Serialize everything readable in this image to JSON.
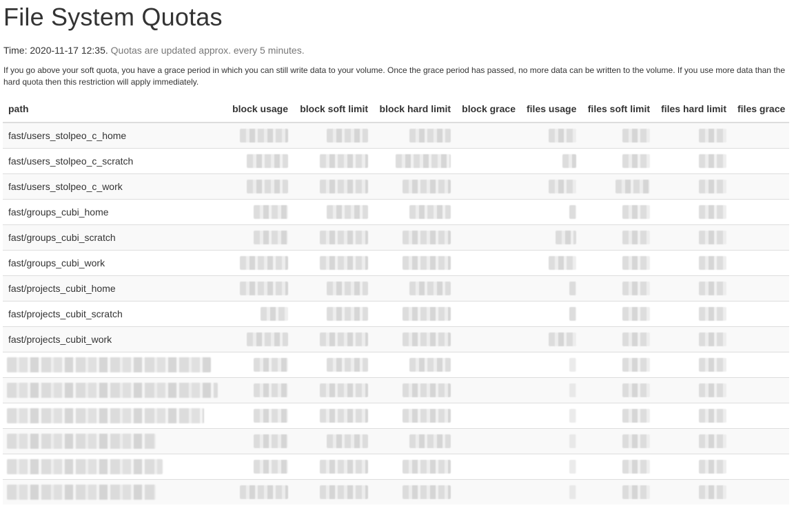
{
  "page": {
    "title": "File System Quotas",
    "time_label": "Time: 2020-11-17 12:35.",
    "update_note": "Quotas are updated approx. every 5 minutes.",
    "notice": "If you go above your soft quota, you have a grace period in which you can still write data to your volume. Once the grace period has passed, no more data can be written to the volume. If you use more data than the hard quota then this restriction will apply immediately."
  },
  "table": {
    "headers": [
      "path",
      "block usage",
      "block soft limit",
      "block hard limit",
      "block grace",
      "files usage",
      "files soft limit",
      "files hard limit",
      "files grace"
    ],
    "rows": [
      {
        "path": "fast/users_stolpeo_c_home"
      },
      {
        "path": "fast/users_stolpeo_c_scratch"
      },
      {
        "path": "fast/users_stolpeo_c_work"
      },
      {
        "path": "fast/groups_cubi_home"
      },
      {
        "path": "fast/groups_cubi_scratch"
      },
      {
        "path": "fast/groups_cubi_work"
      },
      {
        "path": "fast/projects_cubit_home"
      },
      {
        "path": "fast/projects_cubit_scratch"
      },
      {
        "path": "fast/projects_cubit_work"
      },
      {
        "path": ""
      },
      {
        "path": ""
      },
      {
        "path": ""
      },
      {
        "path": ""
      },
      {
        "path": ""
      },
      {
        "path": ""
      }
    ]
  }
}
